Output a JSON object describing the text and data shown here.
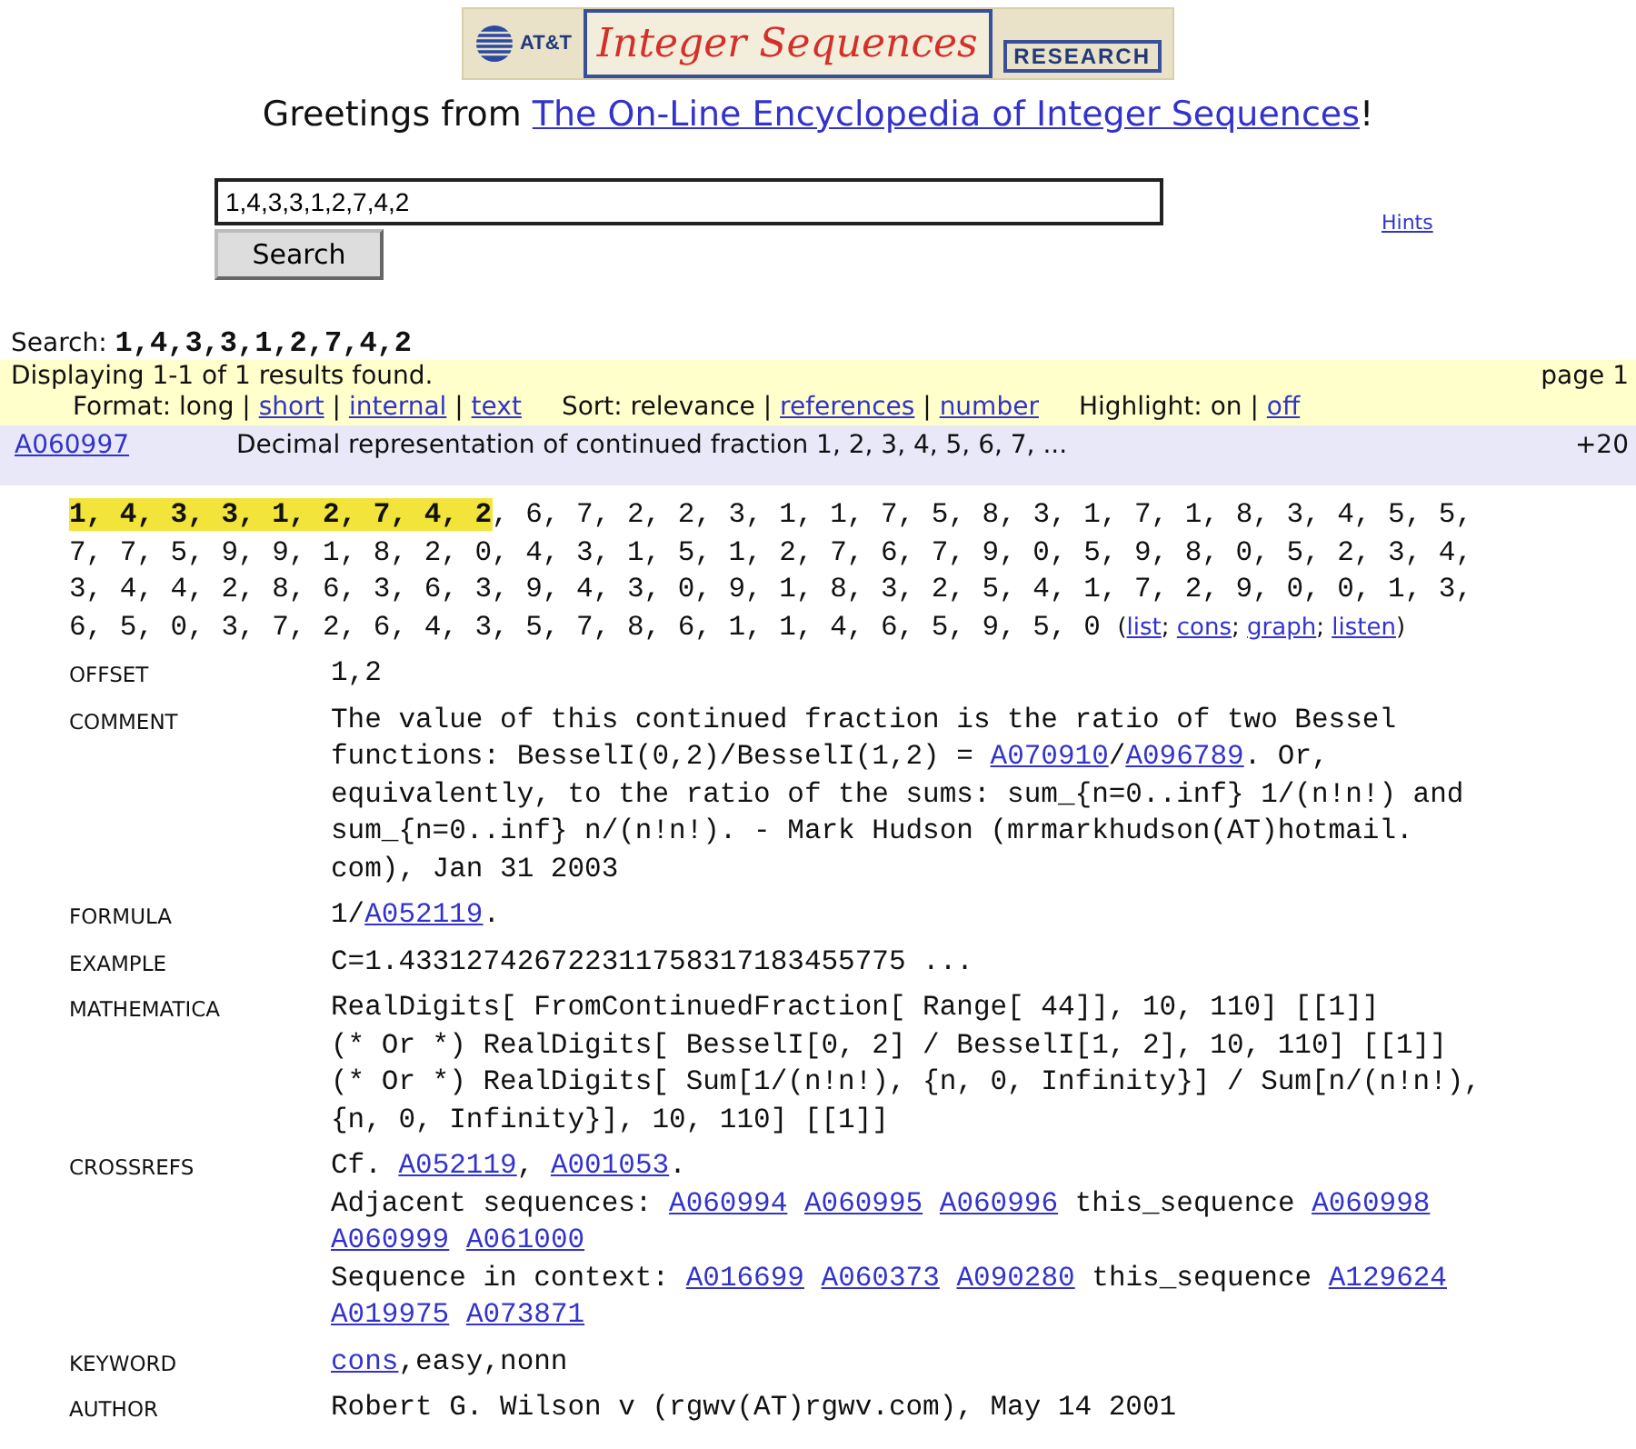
{
  "logo": {
    "company": "AT&T",
    "title": "Integer Sequences",
    "division": "RESEARCH"
  },
  "greeting": [
    {
      "kind": "plain",
      "text": "Greetings from "
    },
    {
      "kind": "link",
      "text": "The On-Line Encyclopedia of Integer Sequences"
    },
    {
      "kind": "plain",
      "text": "!"
    }
  ],
  "search": {
    "value": "1,4,3,3,1,2,7,4,2",
    "button": "Search",
    "hints": "Hints"
  },
  "search_echo": {
    "label": "Search:",
    "query": "1,4,3,3,1,2,7,4,2"
  },
  "results_bar": {
    "summary": "Displaying 1-1 of 1 results found.",
    "page": "page 1",
    "options": [
      [
        {
          "kind": "plain",
          "text": "Format: long | "
        },
        {
          "kind": "link",
          "text": "short"
        },
        {
          "kind": "plain",
          "text": " | "
        },
        {
          "kind": "link",
          "text": "internal"
        },
        {
          "kind": "plain",
          "text": " | "
        },
        {
          "kind": "link",
          "text": "text"
        }
      ],
      [
        {
          "kind": "plain",
          "text": "Sort: relevance | "
        },
        {
          "kind": "link",
          "text": "references"
        },
        {
          "kind": "plain",
          "text": " | "
        },
        {
          "kind": "link",
          "text": "number"
        }
      ],
      [
        {
          "kind": "plain",
          "text": "Highlight: on | "
        },
        {
          "kind": "link",
          "text": "off"
        }
      ]
    ]
  },
  "result": {
    "id": "A060997",
    "title": "Decimal representation of continued fraction 1, 2, 3, 4, 5, 6, 7, ...",
    "extra": "+20",
    "terms": [
      [
        {
          "kind": "highlight",
          "text": "1, 4, 3, 3, 1, 2, 7, 4, 2"
        },
        {
          "kind": "plain",
          "text": ", 6, 7, 2, 2, 3, 1, 1, 7, 5, 8, 3, 1, 7, 1, 8, 3, 4, 5, 5,"
        }
      ],
      [
        {
          "kind": "plain",
          "text": "7, 7, 5, 9, 9, 1, 8, 2, 0, 4, 3, 1, 5, 1, 2, 7, 6, 7, 9, 0, 5, 9, 8, 0, 5, 2, 3, 4,"
        }
      ],
      [
        {
          "kind": "plain",
          "text": "3, 4, 4, 2, 8, 6, 3, 6, 3, 9, 4, 3, 0, 9, 1, 8, 3, 2, 5, 4, 1, 7, 2, 9, 0, 0, 1, 3,"
        }
      ],
      [
        {
          "kind": "plain",
          "text": "6, 5, 0, 3, 7, 2, 6, 4, 3, 5, 7, 8, 6, 1, 1, 4, 6, 5, 9, 5, 0"
        }
      ]
    ],
    "term_links": [
      {
        "kind": "plain",
        "text": "("
      },
      {
        "kind": "link",
        "text": "list"
      },
      {
        "kind": "plain",
        "text": "; "
      },
      {
        "kind": "link",
        "text": "cons"
      },
      {
        "kind": "plain",
        "text": "; "
      },
      {
        "kind": "link",
        "text": "graph"
      },
      {
        "kind": "plain",
        "text": "; "
      },
      {
        "kind": "link",
        "text": "listen"
      },
      {
        "kind": "plain",
        "text": ")"
      }
    ],
    "fields": [
      {
        "label": "OFFSET",
        "lines": [
          [
            {
              "kind": "plain",
              "text": "1,2"
            }
          ]
        ]
      },
      {
        "label": "COMMENT",
        "lines": [
          [
            {
              "kind": "plain",
              "text": "The value of this continued fraction is the ratio of two Bessel"
            }
          ],
          [
            {
              "kind": "plain",
              "text": "functions: BesselI(0,2)/BesselI(1,2) = "
            },
            {
              "kind": "link",
              "text": "A070910"
            },
            {
              "kind": "plain",
              "text": "/"
            },
            {
              "kind": "link",
              "text": "A096789"
            },
            {
              "kind": "plain",
              "text": ". Or,"
            }
          ],
          [
            {
              "kind": "plain",
              "text": "equivalently, to the ratio of the sums: sum_{n=0..inf} 1/(n!n!) and"
            }
          ],
          [
            {
              "kind": "plain",
              "text": "sum_{n=0..inf} n/(n!n!). - Mark Hudson (mrmarkhudson(AT)hotmail."
            }
          ],
          [
            {
              "kind": "plain",
              "text": "com), Jan 31 2003"
            }
          ]
        ]
      },
      {
        "label": "FORMULA",
        "lines": [
          [
            {
              "kind": "plain",
              "text": "1/"
            },
            {
              "kind": "link",
              "text": "A052119"
            },
            {
              "kind": "plain",
              "text": "."
            }
          ]
        ]
      },
      {
        "label": "EXAMPLE",
        "lines": [
          [
            {
              "kind": "plain",
              "text": "C=1.433127426722311758317183455775 ..."
            }
          ]
        ]
      },
      {
        "label": "MATHEMATICA",
        "lines": [
          [
            {
              "kind": "plain",
              "text": "RealDigits[ FromContinuedFraction[ Range[ 44]], 10, 110] [[1]]"
            }
          ],
          [
            {
              "kind": "plain",
              "text": "(* Or *) RealDigits[ BesselI[0, 2] / BesselI[1, 2], 10, 110] [[1]]"
            }
          ],
          [
            {
              "kind": "plain",
              "text": "(* Or *) RealDigits[ Sum[1/(n!n!), {n, 0, Infinity}] / Sum[n/(n!n!),"
            }
          ],
          [
            {
              "kind": "plain",
              "text": "{n, 0, Infinity}], 10, 110] [[1]]"
            }
          ]
        ]
      },
      {
        "label": "CROSSREFS",
        "lines": [
          [
            {
              "kind": "plain",
              "text": "Cf. "
            },
            {
              "kind": "link",
              "text": "A052119"
            },
            {
              "kind": "plain",
              "text": ", "
            },
            {
              "kind": "link",
              "text": "A001053"
            },
            {
              "kind": "plain",
              "text": "."
            }
          ],
          [
            {
              "kind": "plain",
              "text": "Adjacent sequences: "
            },
            {
              "kind": "link",
              "text": "A060994"
            },
            {
              "kind": "link",
              "text": "A060995"
            },
            {
              "kind": "link",
              "text": "A060996"
            },
            {
              "kind": "plain",
              "text": " this_sequence "
            },
            {
              "kind": "link",
              "text": "A060998"
            }
          ],
          [
            {
              "kind": "link",
              "text": "A060999"
            },
            {
              "kind": "link",
              "text": "A061000"
            }
          ],
          [
            {
              "kind": "plain",
              "text": "Sequence in context: "
            },
            {
              "kind": "link",
              "text": "A016699"
            },
            {
              "kind": "link",
              "text": "A060373"
            },
            {
              "kind": "link",
              "text": "A090280"
            },
            {
              "kind": "plain",
              "text": " this_sequence "
            },
            {
              "kind": "link",
              "text": "A129624"
            }
          ],
          [
            {
              "kind": "link",
              "text": "A019975"
            },
            {
              "kind": "link",
              "text": "A073871"
            }
          ]
        ]
      },
      {
        "label": "KEYWORD",
        "lines": [
          [
            {
              "kind": "link",
              "text": "cons"
            },
            {
              "kind": "plain",
              "text": ",easy,nonn"
            }
          ]
        ]
      },
      {
        "label": "AUTHOR",
        "lines": [
          [
            {
              "kind": "plain",
              "text": "Robert G. Wilson v (rgwv(AT)rgwv.com), May 14 2001"
            }
          ]
        ]
      }
    ]
  }
}
